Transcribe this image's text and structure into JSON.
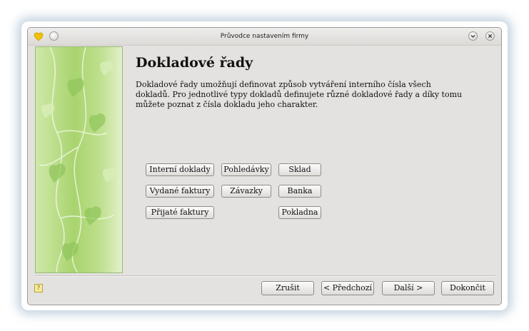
{
  "window": {
    "title": "Průvodce nastavením firmy"
  },
  "page": {
    "heading": "Dokladové řady",
    "description": "Dokladové řady umožňují definovat způsob vytváření interního čísla všech dokladů. Pro jednotlivé typy dokladů definujete různé dokladové řady a díky tomu můžete poznat z čísla dokladu jeho charakter."
  },
  "series_buttons": {
    "internal": "Interní doklady",
    "receivables": "Pohledávky",
    "warehouse": "Sklad",
    "issued_invoices": "Vydané faktury",
    "liabilities": "Závazky",
    "bank": "Banka",
    "received_invoices": "Přijaté faktury",
    "cash_desk": "Pokladna"
  },
  "footer": {
    "cancel": "Zrušit",
    "back": "< Předchozí",
    "next": "Další >",
    "finish": "Dokončit"
  },
  "colors": {
    "window_bg": "#e4e2e0",
    "side_green": "#a8d46e",
    "accent_icon": "#f2c200"
  },
  "icons": {
    "app": "hearts-app-icon",
    "menu": "chevron-down-icon",
    "close": "close-icon",
    "help": "help-icon"
  }
}
